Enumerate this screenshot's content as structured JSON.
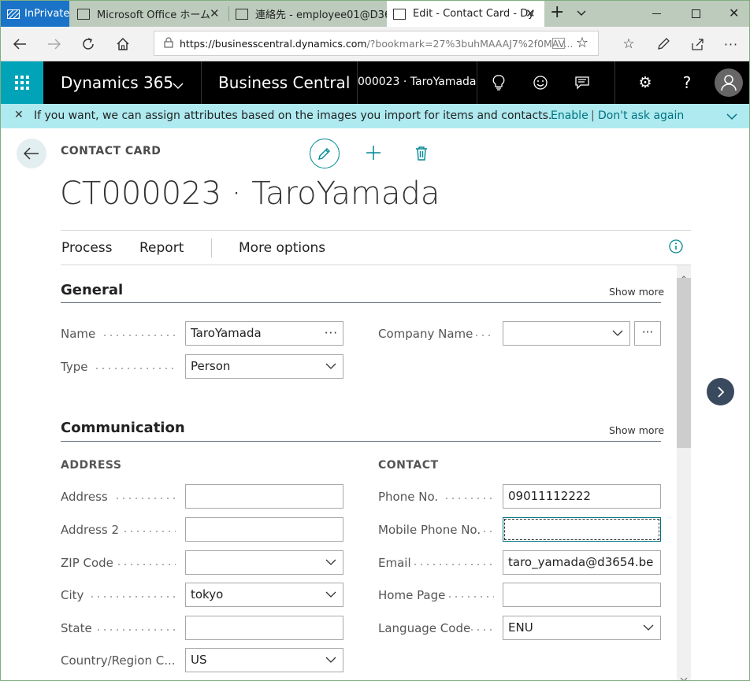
{
  "browser": {
    "tabs": [
      {
        "label": "InPrivate"
      },
      {
        "label": "Microsoft Office ホーム"
      },
      {
        "label": "連絡先 - employee01@D36"
      },
      {
        "label": "Edit - Contact Card - Dy"
      }
    ],
    "url_host": "https://businesscentral.dynamics.com",
    "url_rest": "/?bookmark=27%3buhMAAAJ7%2f0MAV..."
  },
  "appbar": {
    "product": "Dynamics 365",
    "app": "Business Central",
    "record": "000023 · TaroYamada"
  },
  "notification": {
    "message": "If you want, we can assign attributes based on the images you import for items and contacts.",
    "enable": "Enable",
    "separator": "|",
    "dont_ask": "Don't ask again"
  },
  "page": {
    "caption": "CONTACT CARD",
    "title": "CT000023 · TaroYamada",
    "actions": [
      "Process",
      "Report",
      "More options"
    ]
  },
  "general": {
    "title": "General",
    "show_more": "Show more",
    "name_label": "Name",
    "name_value": "TaroYamada",
    "type_label": "Type",
    "type_value": "Person",
    "company_label": "Company Name",
    "company_value": ""
  },
  "communication": {
    "title": "Communication",
    "show_more": "Show more",
    "address_head": "ADDRESS",
    "contact_head": "CONTACT",
    "address_fields": [
      {
        "label": "Address",
        "value": ""
      },
      {
        "label": "Address 2",
        "value": ""
      },
      {
        "label": "ZIP Code",
        "value": ""
      },
      {
        "label": "City",
        "value": "tokyo"
      },
      {
        "label": "State",
        "value": ""
      },
      {
        "label": "Country/Region C...",
        "value": "US"
      }
    ],
    "contact_fields": [
      {
        "label": "Phone No.",
        "value": "09011112222"
      },
      {
        "label": "Mobile Phone No.",
        "value": ""
      },
      {
        "label": "Email",
        "value": "taro_yamada@d3654.be"
      },
      {
        "label": "Home Page",
        "value": ""
      },
      {
        "label": "Language Code",
        "value": "ENU"
      }
    ]
  },
  "colors": {
    "accent": "#008894",
    "notification_bg": "#aeeaf0",
    "appbar_bg": "#000000",
    "waffle_bg": "#00a3b8"
  }
}
